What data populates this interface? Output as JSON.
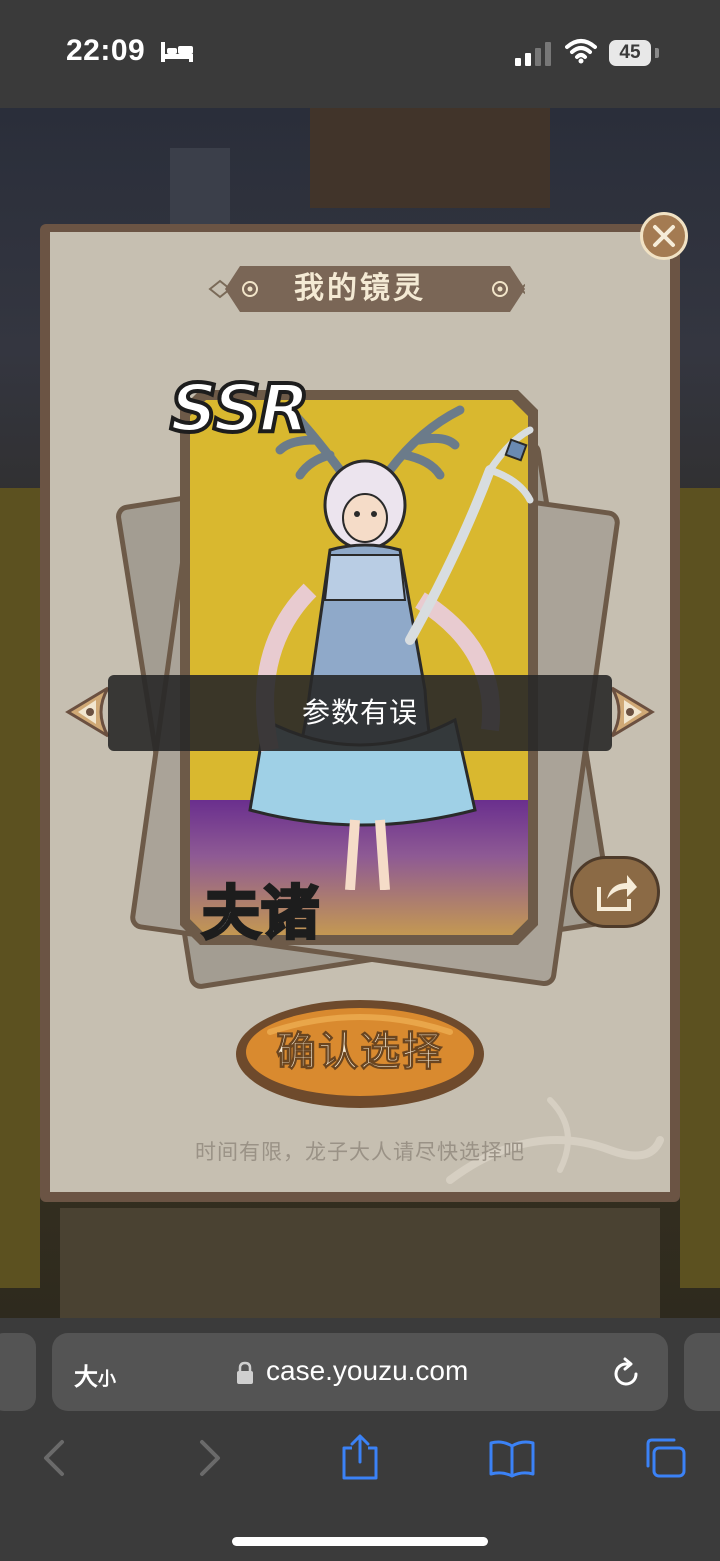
{
  "status_bar": {
    "time": "22:09",
    "battery": "45",
    "icons": [
      "bed-icon",
      "signal-icon",
      "wifi-icon",
      "battery-icon"
    ]
  },
  "modal": {
    "title": "我的镜灵",
    "card": {
      "rarity": "SSR",
      "name": "夫诸"
    },
    "toast": "参数有误",
    "confirm_button": "确认选择",
    "hint": "时间有限，龙子大人请尽快选择吧",
    "icons": [
      "close-icon",
      "arrow-left-icon",
      "arrow-right-icon",
      "share-icon"
    ]
  },
  "browser": {
    "text_size_label_big": "大",
    "text_size_label_small": "小",
    "url": "case.youzu.com",
    "icons": [
      "lock-icon",
      "reload-icon",
      "back-icon",
      "forward-icon",
      "share-icon",
      "bookmarks-icon",
      "tabs-icon"
    ]
  },
  "colors": {
    "modal_bg": "#c6bfb1",
    "card_yellow": "#d9b82f",
    "accent_brown": "#6b5444",
    "button_orange": "#d98a2f",
    "browser_blue": "#3b82f6"
  }
}
